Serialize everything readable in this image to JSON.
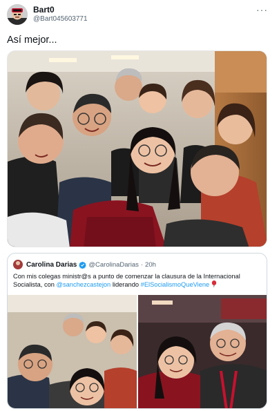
{
  "tweet": {
    "author_name": "Bart0",
    "author_handle": "@Bart045603771",
    "text": "Así mejor...",
    "more_icon": "more-horizontal-icon",
    "media_alt": "group-selfie-photo"
  },
  "quote": {
    "author_name": "Carolina Darias",
    "verified_icon": "verified-badge-icon",
    "author_handle": "@CarolinaDarias",
    "separator": "·",
    "time": "20h",
    "text_before": "Con mis colegas ministr@s a punto de comenzar la clausura de la Internacional Socialista, con ",
    "mention": "@sanchezcastejon",
    "text_middle": " liderando ",
    "hashtag": "#ElSocialismoQueViene",
    "balloon_icon": "red-balloon-icon"
  },
  "colors": {
    "link": "#1d9bf0",
    "verified": "#1d9bf0",
    "text_primary": "#0f1419",
    "text_secondary": "#536471",
    "border": "#cfd9de"
  }
}
